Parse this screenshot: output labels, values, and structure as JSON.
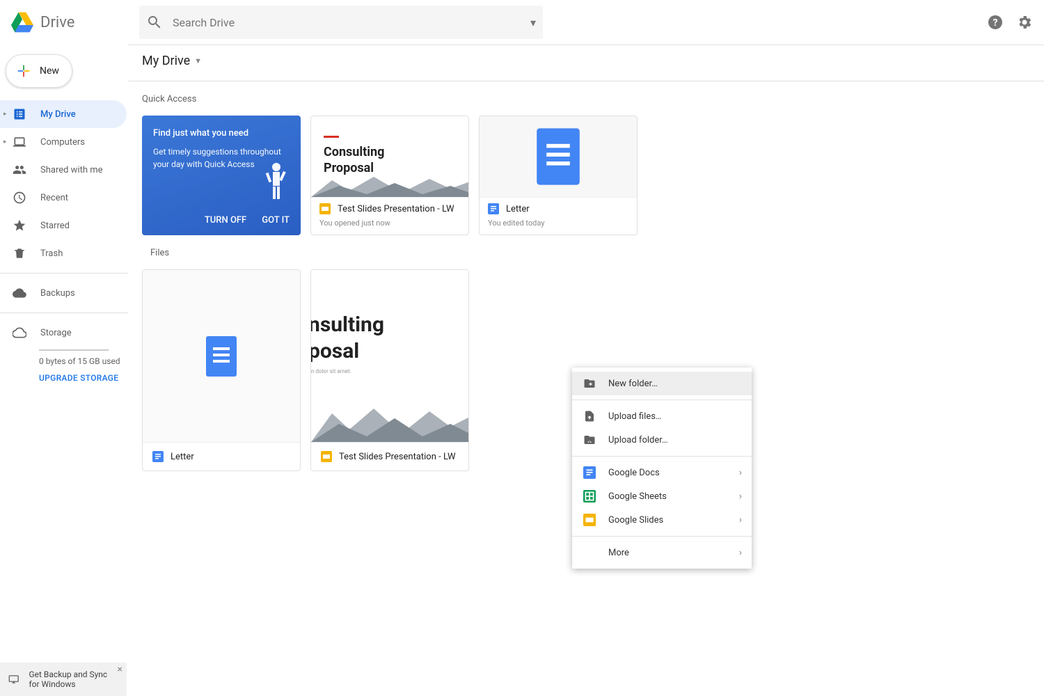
{
  "header": {
    "app_name": "Drive",
    "search_placeholder": "Search Drive"
  },
  "sidebar": {
    "new_label": "New",
    "items": [
      {
        "label": "My Drive"
      },
      {
        "label": "Computers"
      },
      {
        "label": "Shared with me"
      },
      {
        "label": "Recent"
      },
      {
        "label": "Starred"
      },
      {
        "label": "Trash"
      }
    ],
    "backups_label": "Backups",
    "storage_label": "Storage",
    "storage_used": "0 bytes of 15 GB used",
    "upgrade_label": "UPGRADE STORAGE"
  },
  "main": {
    "breadcrumb": "My Drive",
    "quick_access_label": "Quick Access",
    "promo": {
      "title": "Find just what you need",
      "desc": "Get timely suggestions throughout your day with Quick Access",
      "turn_off": "TURN OFF",
      "got_it": "GOT IT"
    },
    "quick_access": [
      {
        "name": "Test Slides Presentation - LW",
        "subtitle": "You opened just now",
        "type": "slides"
      },
      {
        "name": "Letter",
        "subtitle": "You edited today",
        "type": "docs"
      }
    ],
    "files_label": "Files",
    "files": [
      {
        "name": "Letter",
        "type": "docs"
      },
      {
        "name": "Test Slides Presentation - LW",
        "type": "slides"
      }
    ],
    "proposal": {
      "line1": "Consulting",
      "line2": "Proposal",
      "big_l1": "nsulting",
      "big_l2": "posal",
      "sub": "n dolor sit amet."
    }
  },
  "context_menu": {
    "new_folder": "New folder…",
    "upload_files": "Upload files…",
    "upload_folder": "Upload folder…",
    "google_docs": "Google Docs",
    "google_sheets": "Google Sheets",
    "google_slides": "Google Slides",
    "more": "More"
  },
  "banner": {
    "text": "Get Backup and Sync for Windows"
  }
}
